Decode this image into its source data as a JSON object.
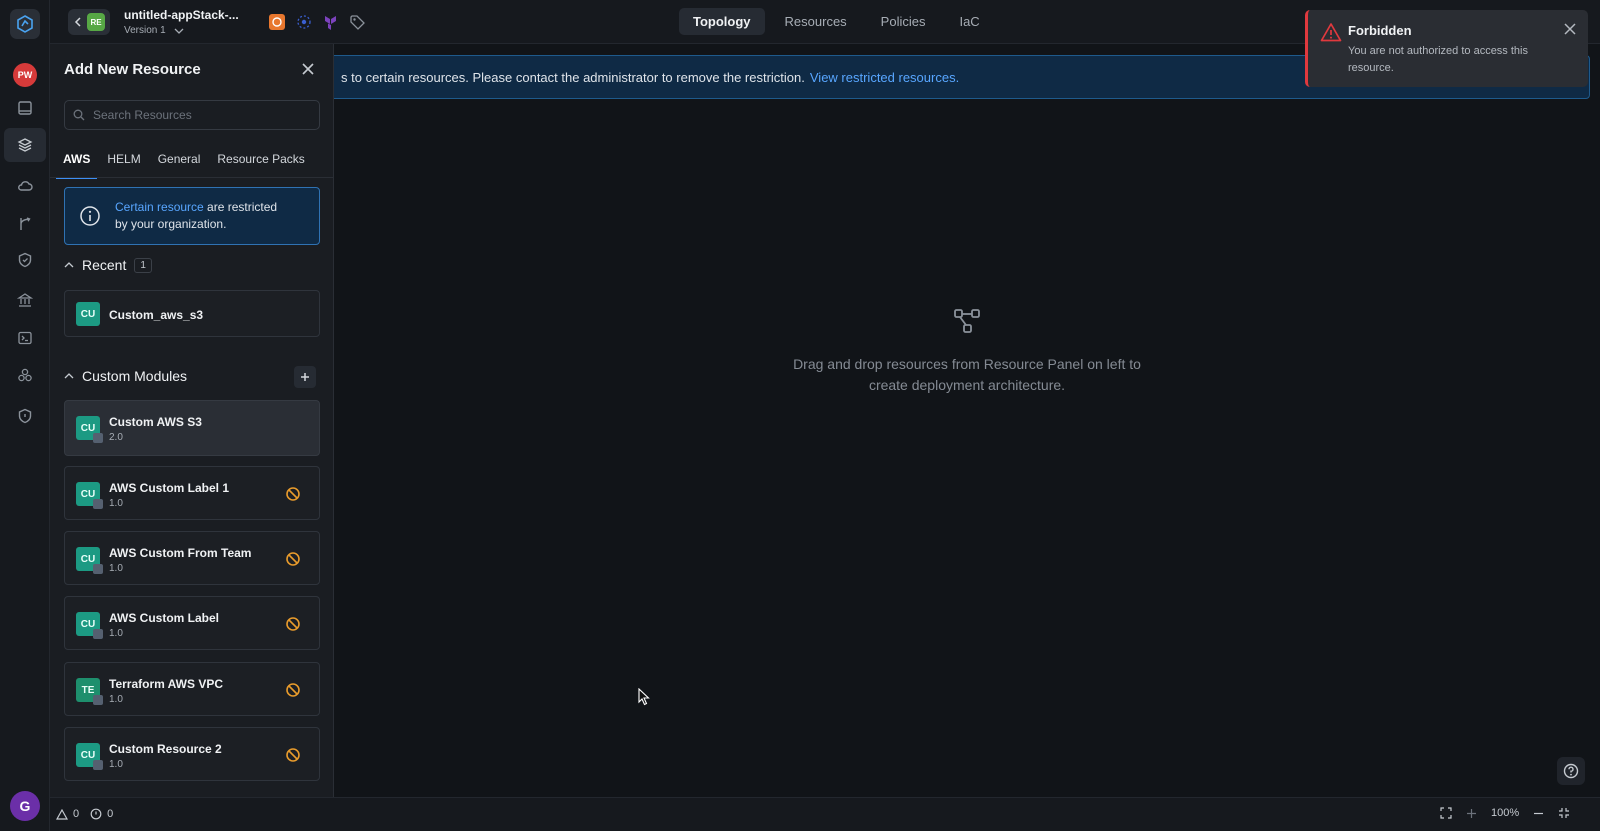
{
  "topbar": {
    "stack_badge": "RE",
    "stack_name": "untitled-appStack-...",
    "version": "Version 1",
    "tabs": [
      {
        "label": "Topology",
        "active": true
      },
      {
        "label": "Resources",
        "active": false
      },
      {
        "label": "Policies",
        "active": false
      },
      {
        "label": "IaC",
        "active": false
      }
    ]
  },
  "rail": {
    "badge": "PW",
    "avatar": "G",
    "icons": [
      "book-icon",
      "layers-icon",
      "cloud-icon",
      "branch-icon",
      "shield-check-icon",
      "bank-icon",
      "terminal-icon",
      "modules-icon",
      "shield-icon"
    ]
  },
  "banner": {
    "text": "s to certain resources. Please contact the administrator to remove the restriction.",
    "link": "View restricted resources."
  },
  "panel": {
    "title": "Add New Resource",
    "search_placeholder": "Search Resources",
    "tabs": [
      {
        "label": "AWS",
        "active": true
      },
      {
        "label": "HELM",
        "active": false
      },
      {
        "label": "General",
        "active": false
      },
      {
        "label": "Resource Packs",
        "active": false
      }
    ],
    "info": {
      "link": "Certain resource",
      "text_line1": " are restricted",
      "text_line2": "by your organization."
    },
    "recent": {
      "label": "Recent",
      "count": "1",
      "items": [
        {
          "badge": "CU",
          "name": "Custom_aws_s3"
        }
      ]
    },
    "custom_modules": {
      "label": "Custom Modules",
      "items": [
        {
          "badge": "CU",
          "name": "Custom AWS S3",
          "version": "2.0",
          "restricted": false
        },
        {
          "badge": "CU",
          "name": "AWS Custom Label 1",
          "version": "1.0",
          "restricted": true
        },
        {
          "badge": "CU",
          "name": "AWS Custom From Team",
          "version": "1.0",
          "restricted": true
        },
        {
          "badge": "CU",
          "name": "AWS Custom Label",
          "version": "1.0",
          "restricted": true
        },
        {
          "badge": "TE",
          "name": "Terraform AWS VPC",
          "version": "1.0",
          "restricted": true
        },
        {
          "badge": "CU",
          "name": "Custom Resource 2",
          "version": "1.0",
          "restricted": true
        }
      ]
    }
  },
  "canvas": {
    "empty_text": "Drag and drop resources from Resource Panel on left to create deployment architecture."
  },
  "toast": {
    "title": "Forbidden",
    "message": "You are not authorized to access this resource."
  },
  "bottombar": {
    "warnings": "0",
    "errors": "0",
    "zoom": "100%"
  },
  "colors": {
    "accent": "#3d8ff5",
    "link": "#58a6ff",
    "error": "#e0393e",
    "restricted": "#e89b2c",
    "module_badge": "#1c9a83"
  }
}
